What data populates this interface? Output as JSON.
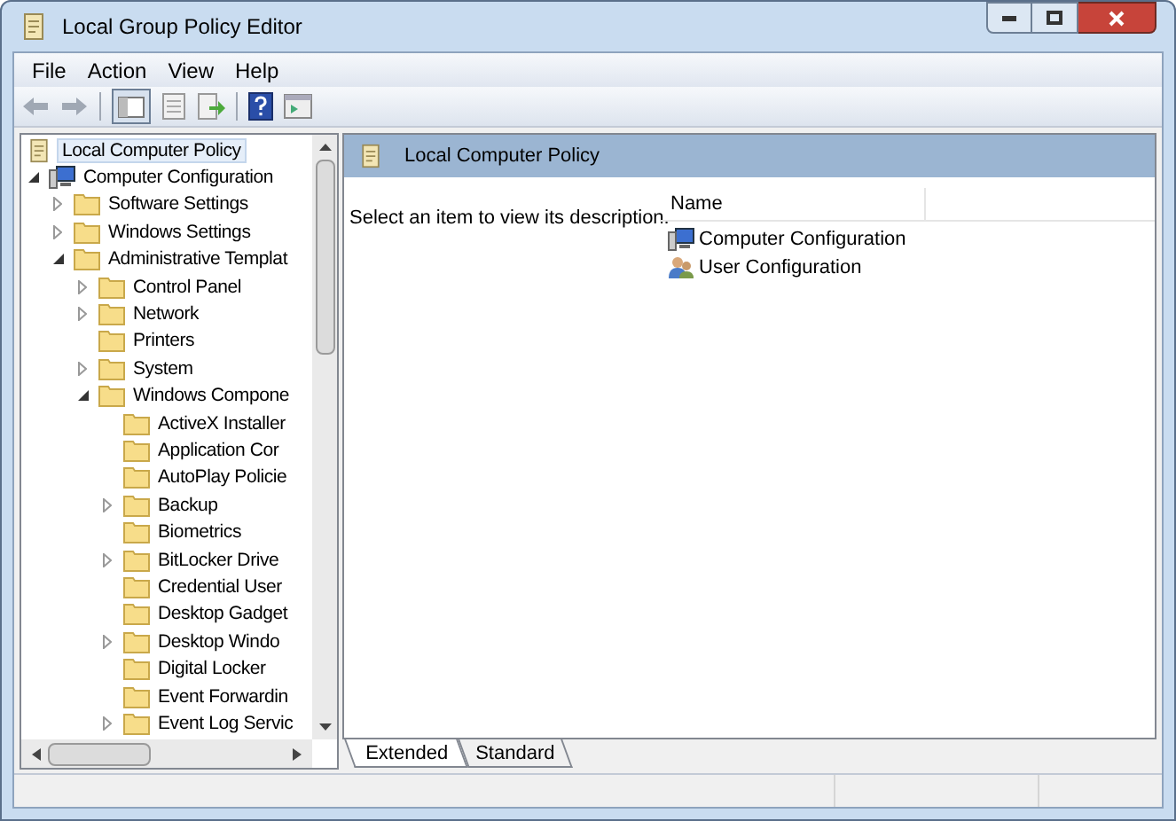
{
  "window": {
    "title": "Local Group Policy Editor"
  },
  "menu": [
    "File",
    "Action",
    "View",
    "Help"
  ],
  "tree": [
    {
      "label": "Local Computer Policy",
      "selected": true,
      "children": [
        {
          "label": "Computer Configuration",
          "expanded": true,
          "selected": false,
          "children": [
            {
              "label": "Software Settings",
              "expanded": false,
              "selected": false
            },
            {
              "label": "Windows Settings",
              "expanded": false,
              "selected": false
            },
            {
              "label": "Administrative Templat",
              "expanded": true,
              "selected": false,
              "children": [
                {
                  "label": "Control Panel",
                  "expanded": false,
                  "selected": false
                },
                {
                  "label": "Network",
                  "expanded": false,
                  "selected": false
                },
                {
                  "label": "Printers",
                  "selected": false
                },
                {
                  "label": "System",
                  "expanded": false,
                  "selected": false
                },
                {
                  "label": "Windows Compone",
                  "expanded": true,
                  "selected": false,
                  "children": [
                    {
                      "label": "ActiveX Installer",
                      "selected": false
                    },
                    {
                      "label": "Application Cor",
                      "selected": false
                    },
                    {
                      "label": "AutoPlay Policie",
                      "selected": false
                    },
                    {
                      "label": "Backup",
                      "expanded": false,
                      "selected": false
                    },
                    {
                      "label": "Biometrics",
                      "selected": false
                    },
                    {
                      "label": "BitLocker Drive",
                      "expanded": false,
                      "selected": false
                    },
                    {
                      "label": "Credential User",
                      "selected": false
                    },
                    {
                      "label": "Desktop Gadget",
                      "selected": false
                    },
                    {
                      "label": "Desktop Windo",
                      "expanded": false,
                      "selected": false
                    },
                    {
                      "label": "Digital Locker",
                      "selected": false
                    },
                    {
                      "label": "Event Forwardin",
                      "selected": false
                    },
                    {
                      "label": "Event Log Servic",
                      "expanded": false,
                      "selected": false
                    }
                  ]
                }
              ]
            }
          ]
        }
      ]
    }
  ],
  "details": {
    "title": "Local Computer Policy",
    "description": "Select an item to view its description.",
    "column": "Name",
    "items": [
      "Computer Configuration",
      "User Configuration"
    ]
  },
  "tabs": [
    {
      "label": "Extended",
      "selected": true
    },
    {
      "label": "Standard",
      "selected": false
    }
  ]
}
